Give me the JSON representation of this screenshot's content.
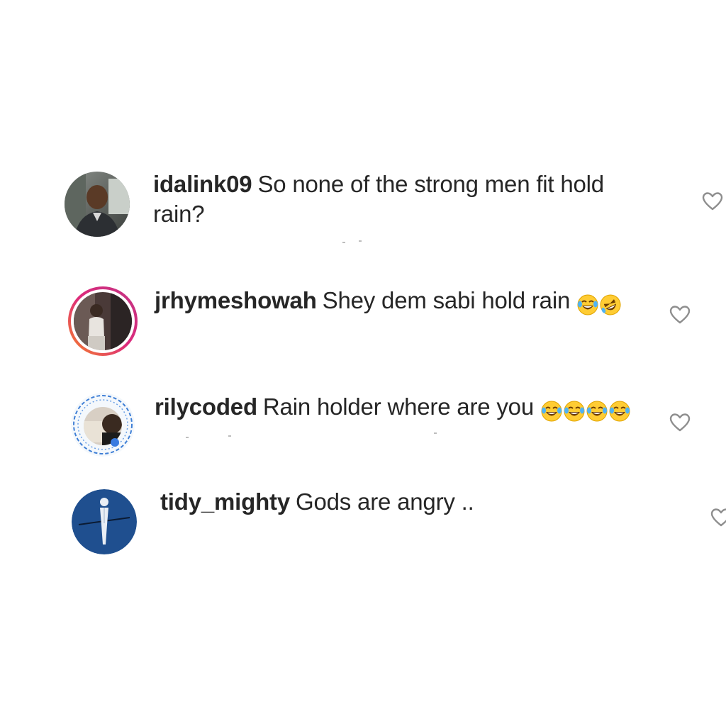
{
  "comments": [
    {
      "username": "idalink09",
      "text_line1": "So none of the strong men fit hold",
      "text_line2": "rain?",
      "avatar_icon": "profile-photo-man-in-car",
      "like_icon": "heart-outline-icon"
    },
    {
      "username": "jrhymeshowah",
      "text_line1": "Shey dem sabi hold rain",
      "emojis": [
        "face-with-tears-of-joy",
        "rolling-on-the-floor-laughing"
      ],
      "avatar_icon": "profile-photo-story-ring",
      "like_icon": "heart-outline-icon"
    },
    {
      "username": "rilycoded",
      "text_line1": "Rain holder where are you",
      "emojis": [
        "face-with-tears-of-joy",
        "face-with-tears-of-joy",
        "face-with-tears-of-joy",
        "face-with-tears-of-joy"
      ],
      "avatar_icon": "profile-photo-decorated-frame",
      "like_icon": "heart-outline-icon"
    },
    {
      "username": "tidy_mighty",
      "text_line1": "Gods are angry ..",
      "avatar_icon": "profile-photo-blue-figure",
      "like_icon": "heart-outline-icon"
    }
  ],
  "colors": {
    "background": "#ffffff",
    "text": "#262626",
    "story_ring_start": "#f58529",
    "story_ring_end": "#c13584",
    "heart_outline": "#8e8e8e",
    "emoji_yellow": "#ffcc33",
    "blue_avatar": "#1f4f8f"
  }
}
